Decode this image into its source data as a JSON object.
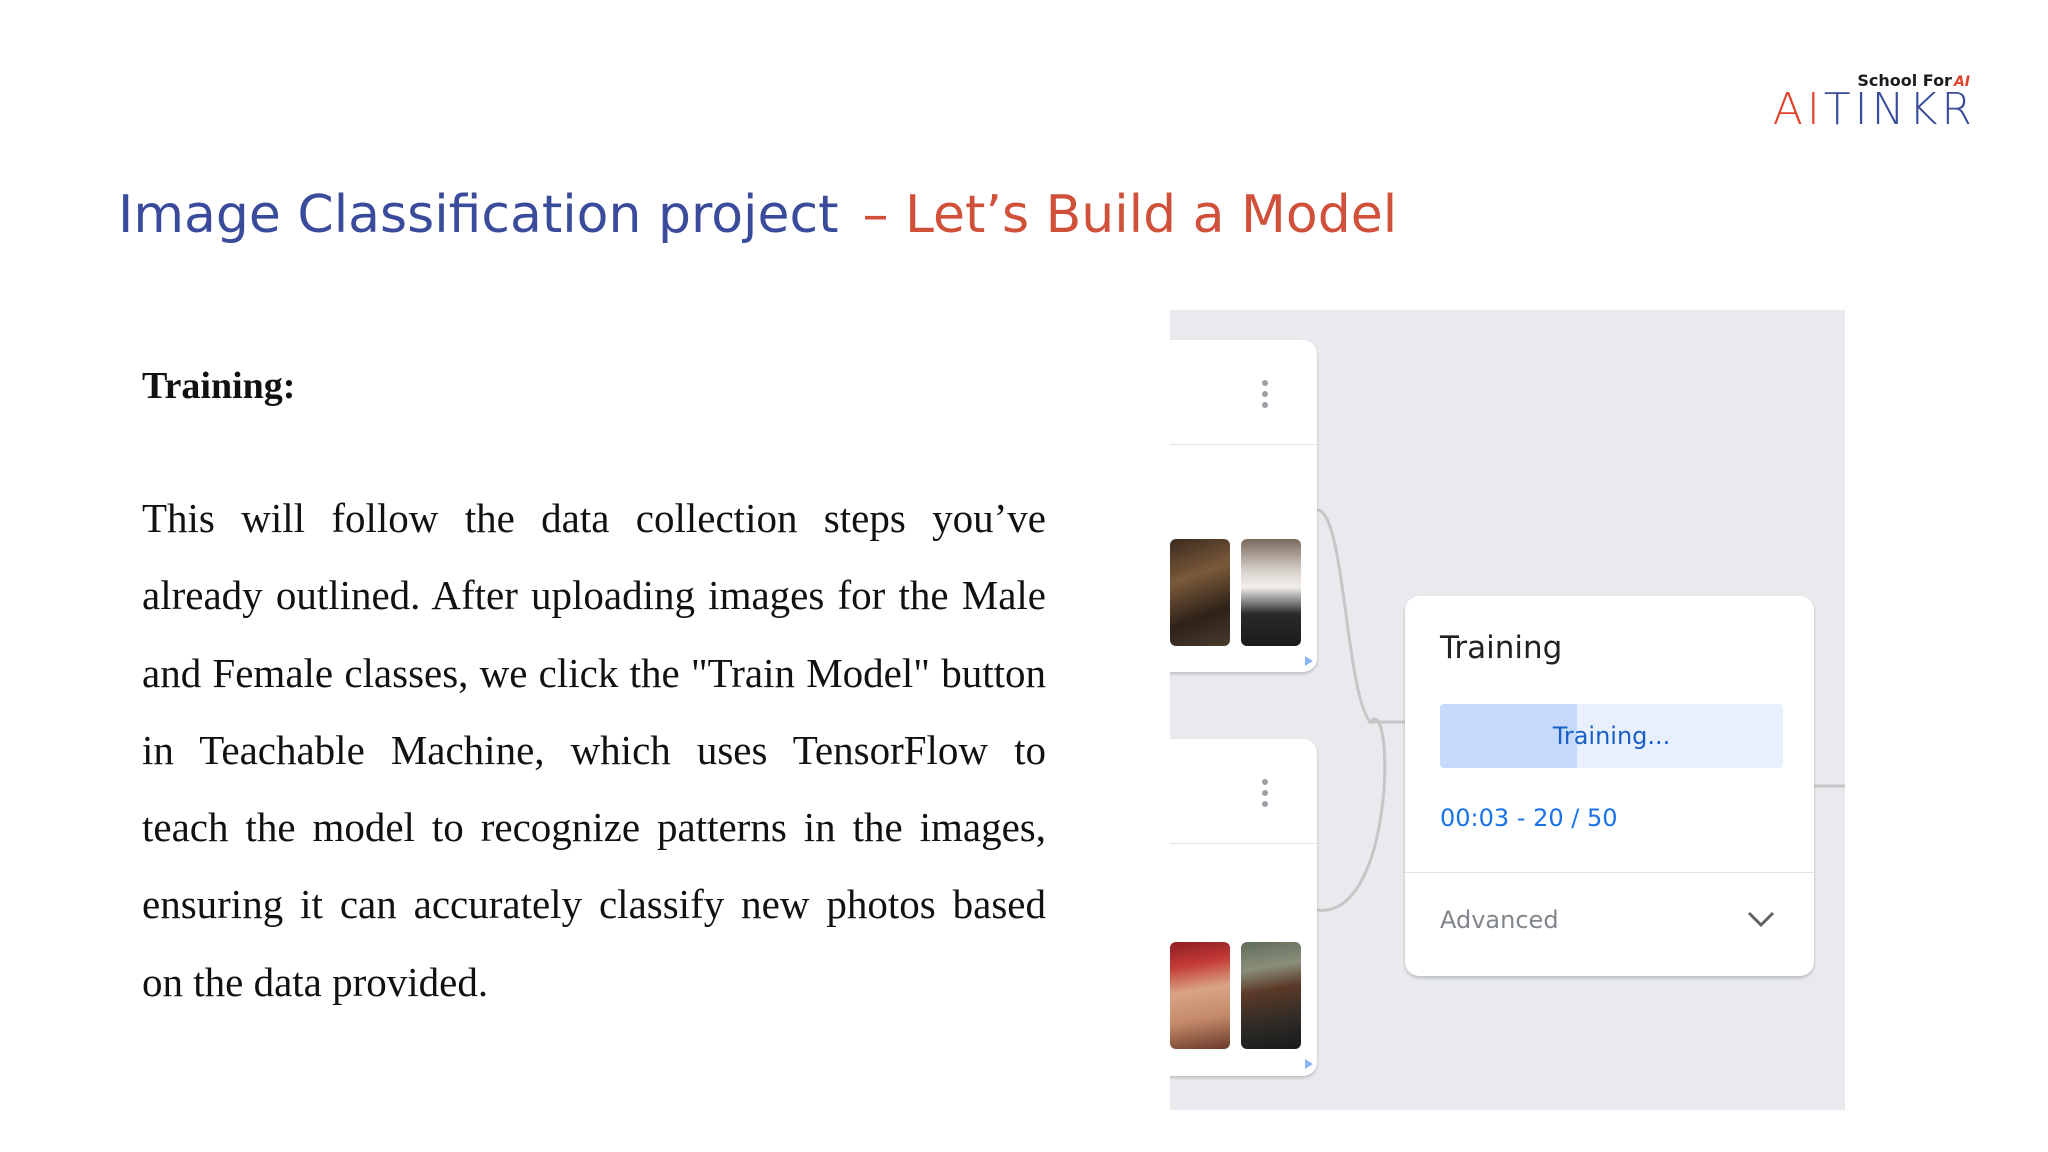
{
  "logo": {
    "tagline": "School For",
    "tagline_mark": "AI",
    "word_a": "AI",
    "word_b": "TINKR"
  },
  "slide": {
    "title": "Image Classification project",
    "subtitle": "– Let’s Build a Model",
    "section_heading": "Training:",
    "body": "This will follow the data collection steps you’ve already outlined. After uploading images for the Male and Female classes, we click the \"Train Model\" button in Teachable Machine, which uses TensorFlow to teach the model to recognize patterns in the images, ensuring it can accurately classify new photos based on the data provided."
  },
  "screenshot": {
    "training_card": {
      "title": "Training",
      "button_label": "Training...",
      "progress_fraction": 0.4,
      "status": "00:03 - 20 / 50",
      "advanced_label": "Advanced"
    }
  },
  "colors": {
    "title_blue": "#3b4b9c",
    "title_red": "#d0503a",
    "accent_blue": "#1a73e8",
    "panel_gray": "#e8eaed"
  },
  "icons": {
    "class_menu": "more-vert-icon",
    "advanced_toggle": "chevron-down-icon",
    "sample_play": "play-icon"
  }
}
